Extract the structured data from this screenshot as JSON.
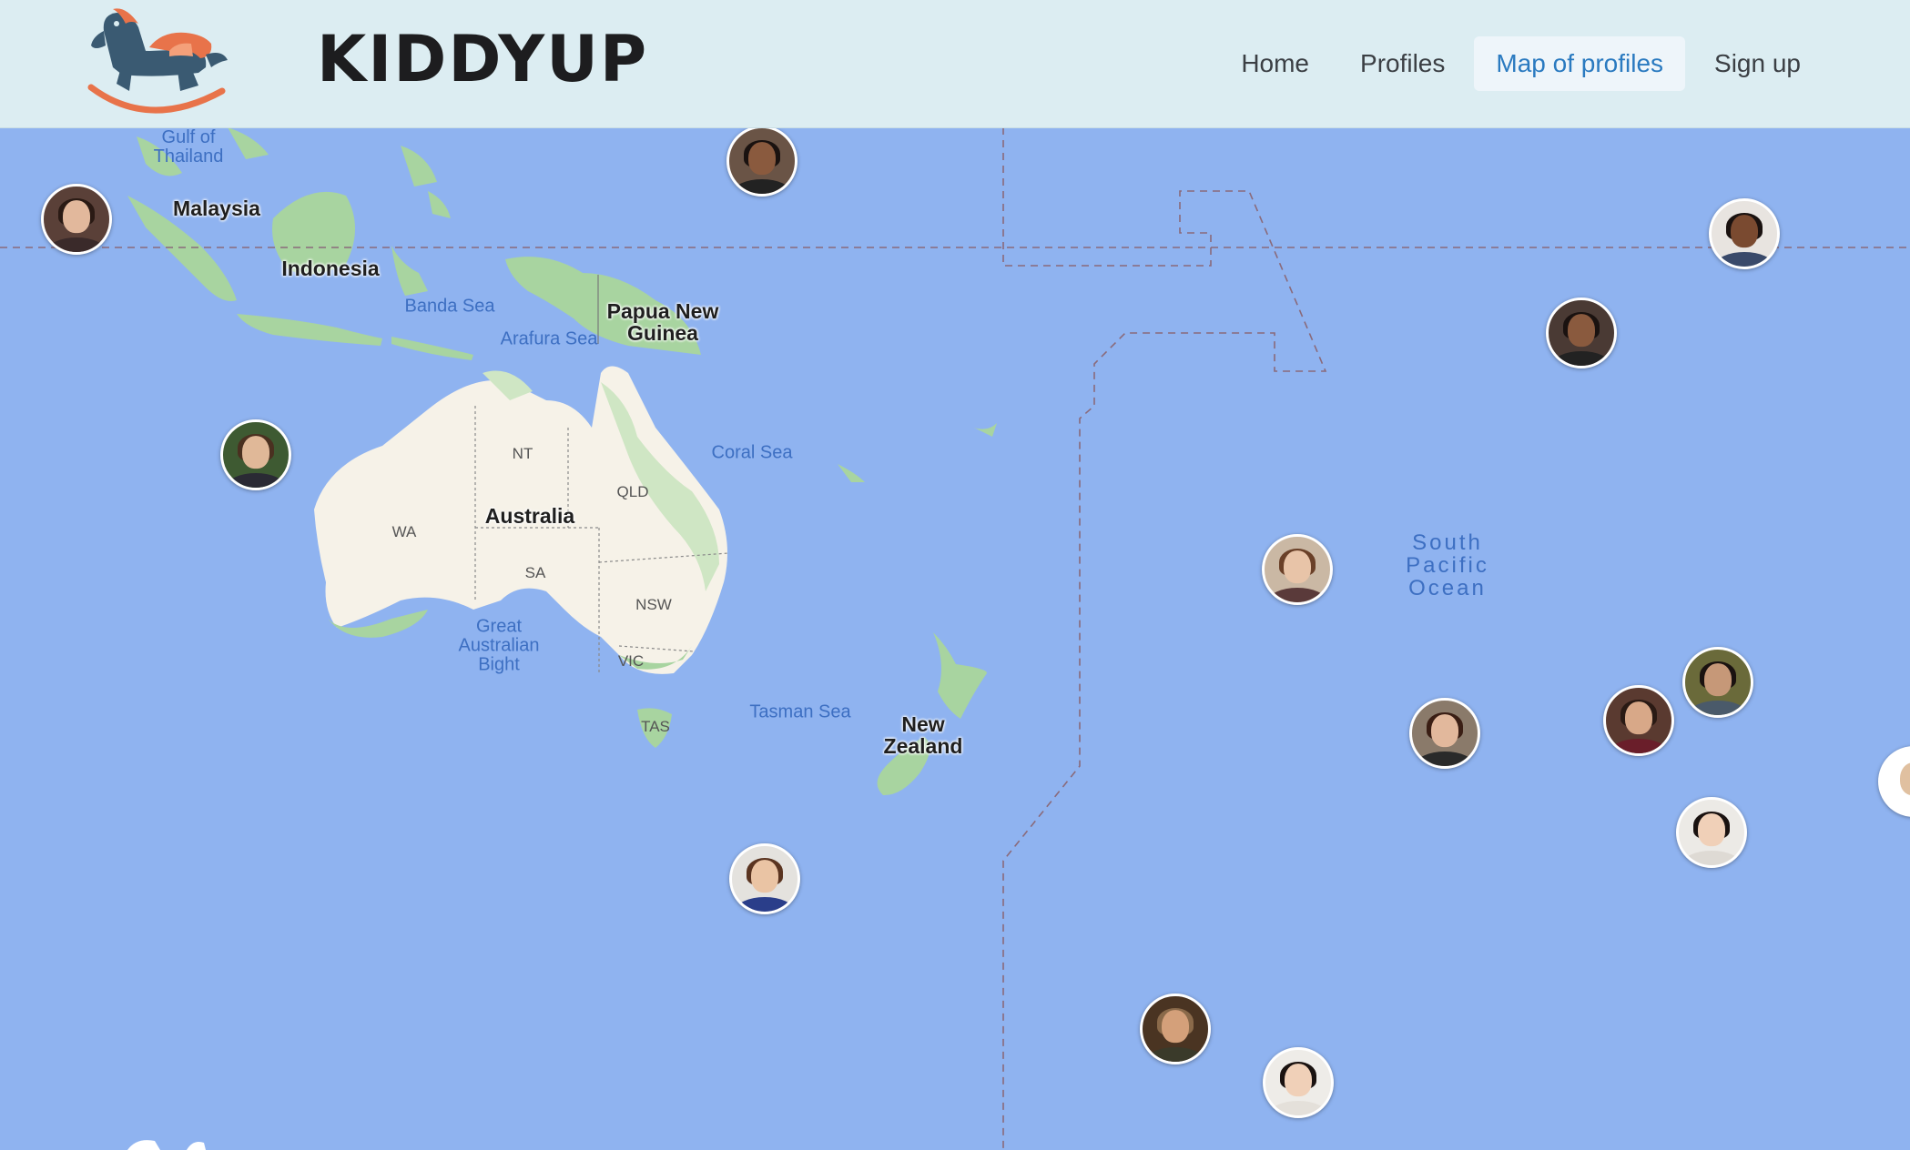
{
  "header": {
    "brand": "KIDDYUP",
    "nav": [
      {
        "label": "Home",
        "active": false
      },
      {
        "label": "Profiles",
        "active": false
      },
      {
        "label": "Map of profiles",
        "active": true
      },
      {
        "label": "Sign up",
        "active": false
      }
    ]
  },
  "map": {
    "countries": [
      "Malaysia",
      "Indonesia",
      "Papua New Guinea",
      "Australia",
      "New Zealand"
    ],
    "seas": [
      "Gulf of Thailand",
      "Banda Sea",
      "Arafura Sea",
      "Coral Sea",
      "Great Australian Bight",
      "Tasman Sea"
    ],
    "ocean": "South Pacific Ocean",
    "states": [
      "NT",
      "QLD",
      "WA",
      "SA",
      "NSW",
      "VIC",
      "TAS"
    ],
    "profile_pin_count": 15
  },
  "colors": {
    "header_bg": "#dcedf2",
    "active_nav": "#2a7ac0",
    "ocean": "#8fb3f0",
    "land": "#f6f2e8",
    "land_green": "#a8d4a0",
    "logo_horse": "#3a5a72",
    "logo_accent": "#e8734a"
  },
  "icons": {
    "logo": "rocking-horse-icon"
  }
}
